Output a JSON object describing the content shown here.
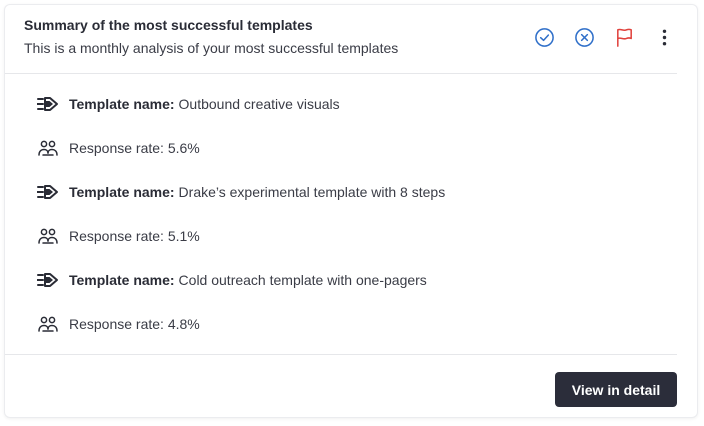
{
  "card": {
    "title": "Summary of the most successful templates",
    "subtitle": "This is a monthly analysis of your most successful templates",
    "actions": [
      {
        "icon": "check-circle-icon",
        "color": "#2f6fc9"
      },
      {
        "icon": "close-circle-icon",
        "color": "#2f6fc9"
      },
      {
        "icon": "flag-icon",
        "color": "#e0413c"
      },
      {
        "icon": "more-vertical-icon",
        "color": "#2a2c36"
      }
    ]
  },
  "templates": [
    {
      "name_label": "Template name:",
      "name": "Outbound creative visuals",
      "response": "Response rate: 5.6%"
    },
    {
      "name_label": "Template name:",
      "name": "Drake’s experimental template with 8 steps",
      "response": "Response rate: 5.1%"
    },
    {
      "name_label": "Template name:",
      "name": "Cold outreach template with one-pagers",
      "response": "Response rate: 4.8%"
    }
  ],
  "footer": {
    "view_button": "View in detail"
  }
}
